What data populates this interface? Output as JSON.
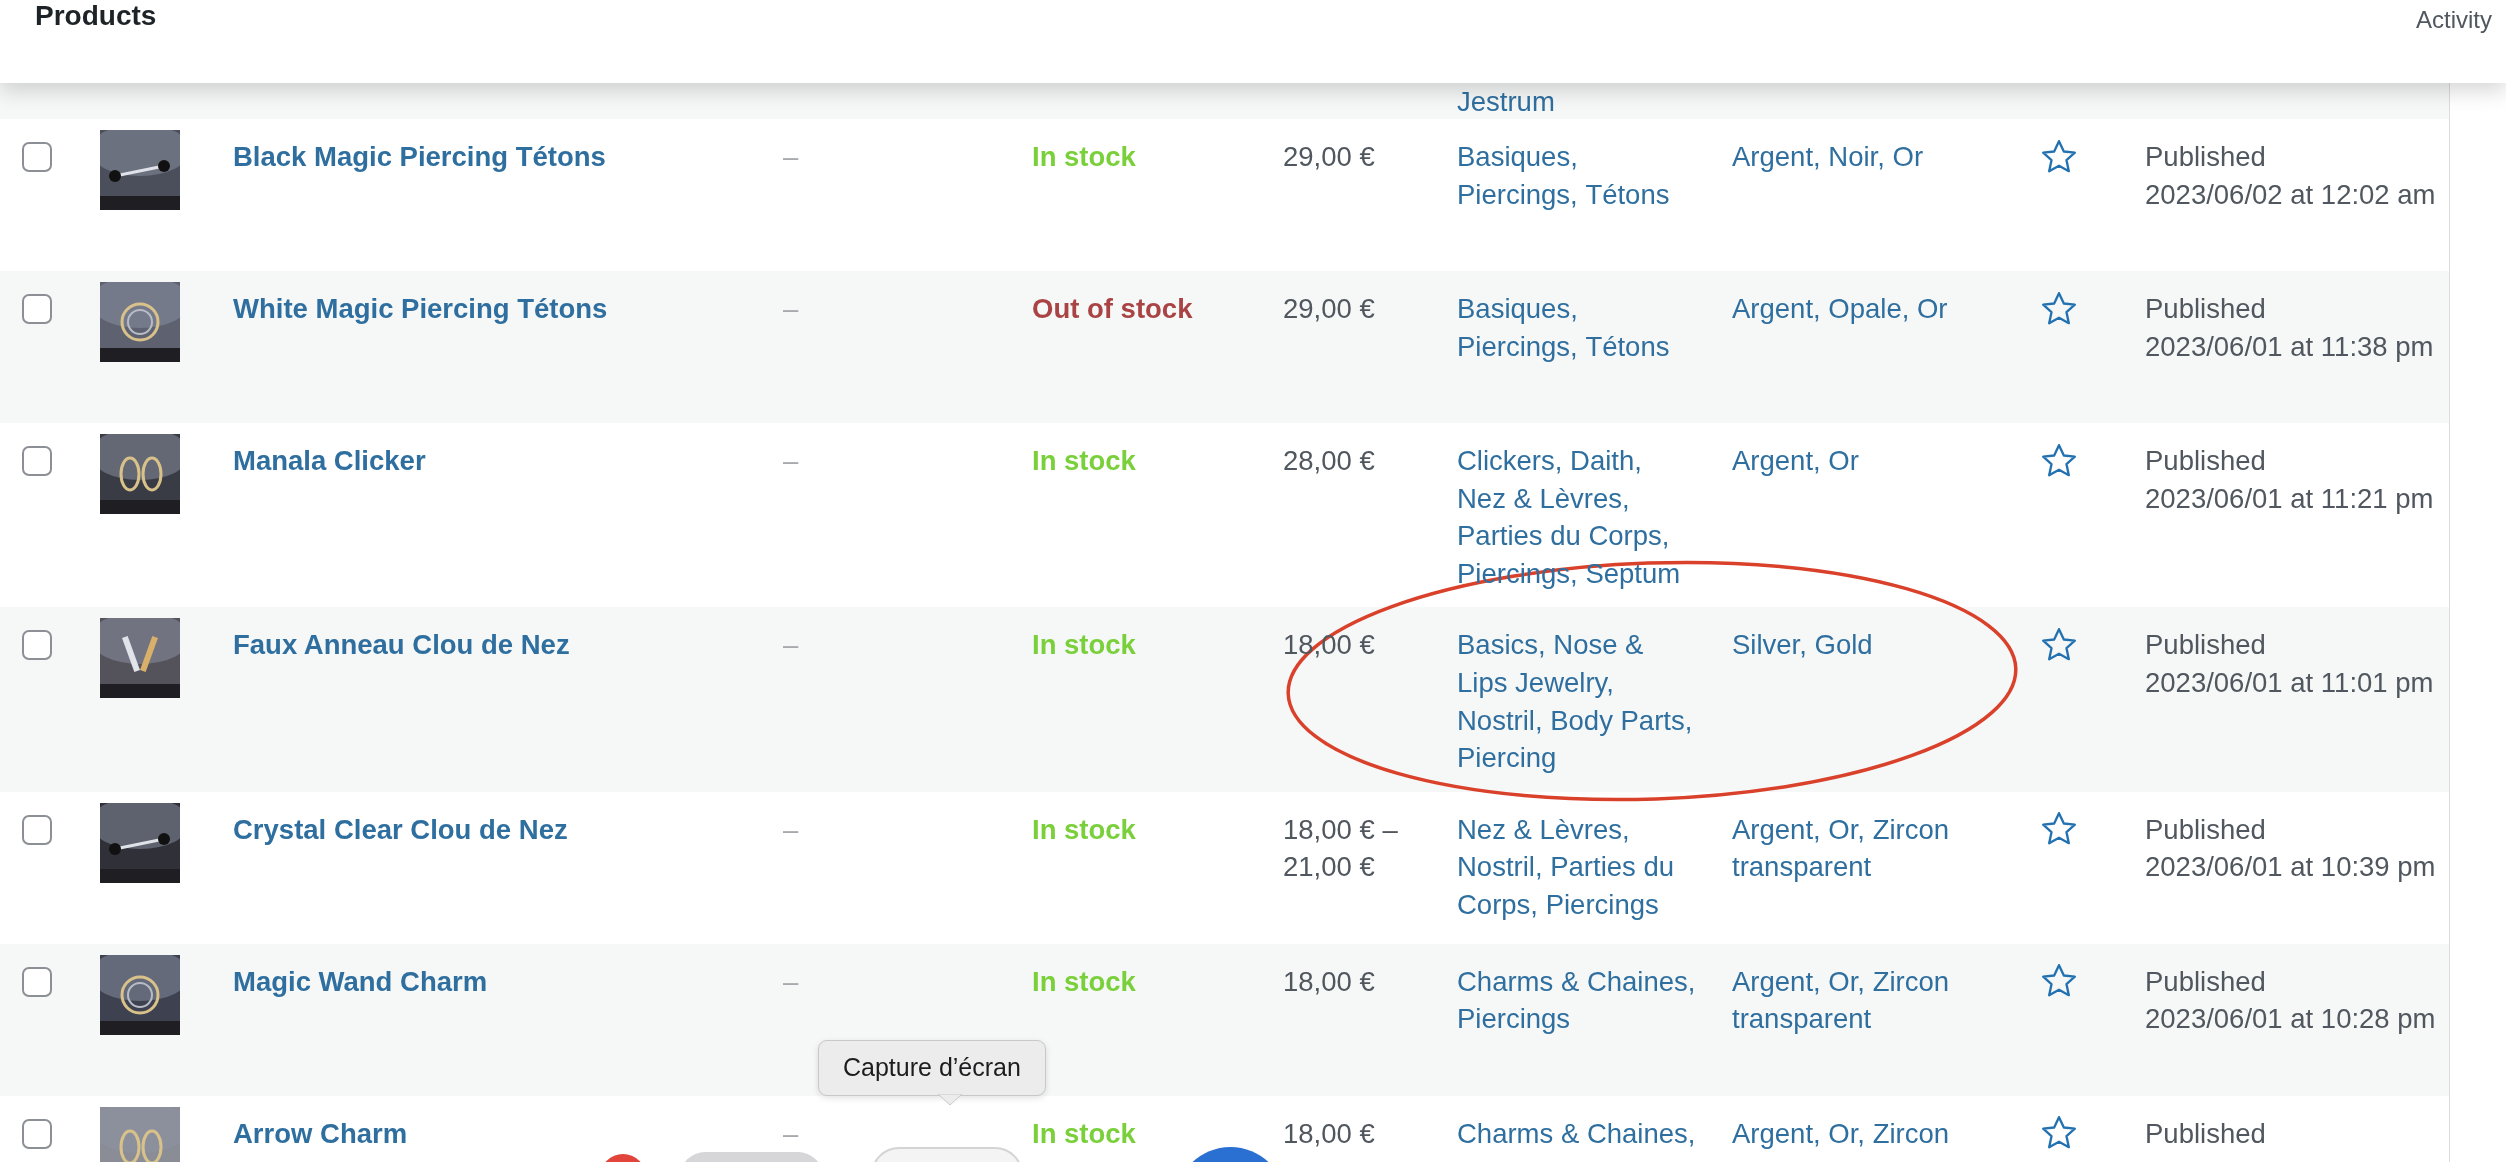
{
  "header": {
    "title": "Products",
    "activity": "Activity"
  },
  "partial_row": {
    "categories": [
      "Jestrum"
    ]
  },
  "products": [
    {
      "name": "Black Magic Piercing Tétons",
      "checked": false,
      "sku": "–",
      "stock": {
        "kind": "instock",
        "text": "In stock"
      },
      "price": "29,00 €",
      "categories": [
        "Basiques,",
        "Piercings,",
        "Tétons"
      ],
      "attributes": [
        "Argent,",
        "Noir,",
        "Or"
      ],
      "featured": false,
      "status": "Published",
      "date": "2023/06/02 at 12:02 am"
    },
    {
      "name": "White Magic Piercing Tétons",
      "checked": false,
      "sku": "–",
      "stock": {
        "kind": "outofstock",
        "text": "Out of stock"
      },
      "price": "29,00 €",
      "categories": [
        "Basiques,",
        "Piercings,",
        "Tétons"
      ],
      "attributes": [
        "Argent,",
        "Opale,",
        "Or"
      ],
      "featured": false,
      "status": "Published",
      "date": "2023/06/01 at 11:38 pm"
    },
    {
      "name": "Manala Clicker",
      "checked": false,
      "sku": "–",
      "stock": {
        "kind": "instock",
        "text": "In stock"
      },
      "price": "28,00 €",
      "categories": [
        "Clickers,",
        "Daith,",
        "Nez & Lèvres,",
        "Parties du Corps,",
        "Piercings,",
        "Septum"
      ],
      "attributes": [
        "Argent,",
        "Or"
      ],
      "featured": false,
      "status": "Published",
      "date": "2023/06/01 at 11:21 pm"
    },
    {
      "name": "Faux Anneau Clou de Nez",
      "checked": false,
      "sku": "–",
      "stock": {
        "kind": "instock",
        "text": "In stock"
      },
      "price": "18,00 €",
      "categories": [
        "Basics,",
        "Nose &",
        "Lips Jewelry,",
        "Nostril,",
        "Body Parts,",
        "Piercing"
      ],
      "attributes": [
        "Silver,",
        "Gold"
      ],
      "featured": false,
      "status": "Published",
      "date": "2023/06/01 at 11:01 pm"
    },
    {
      "name": "Crystal Clear Clou de Nez",
      "checked": false,
      "sku": "–",
      "stock": {
        "kind": "instock",
        "text": "In stock"
      },
      "price": "18,00 € – 21,00 €",
      "categories": [
        "Nez & Lèvres,",
        "Nostril,",
        "Parties du",
        "Corps,",
        "Piercings"
      ],
      "attributes": [
        "Argent,",
        "Or,",
        "Zircon",
        "transparent"
      ],
      "featured": false,
      "status": "Published",
      "date": "2023/06/01 at 10:39 pm"
    },
    {
      "name": "Magic Wand Charm",
      "checked": false,
      "sku": "–",
      "stock": {
        "kind": "instock",
        "text": "In stock"
      },
      "price": "18,00 €",
      "categories": [
        "Charms & Chaines,",
        "Piercings"
      ],
      "attributes": [
        "Argent,",
        "Or,",
        "Zircon",
        "transparent"
      ],
      "featured": false,
      "status": "Published",
      "date": "2023/06/01 at 10:28 pm"
    },
    {
      "name": "Arrow Charm",
      "checked": false,
      "sku": "–",
      "stock": {
        "kind": "instock",
        "text": "In stock"
      },
      "price": "18,00 €",
      "categories": [
        "Charms & Chaines,"
      ],
      "attributes": [
        "Argent,",
        "Or,",
        "Zircon"
      ],
      "featured": false,
      "status": "Published"
    }
  ],
  "annotation": {
    "kind": "ellipse",
    "color": "#d9412b"
  },
  "tooltip": {
    "text": "Capture d’écran"
  }
}
